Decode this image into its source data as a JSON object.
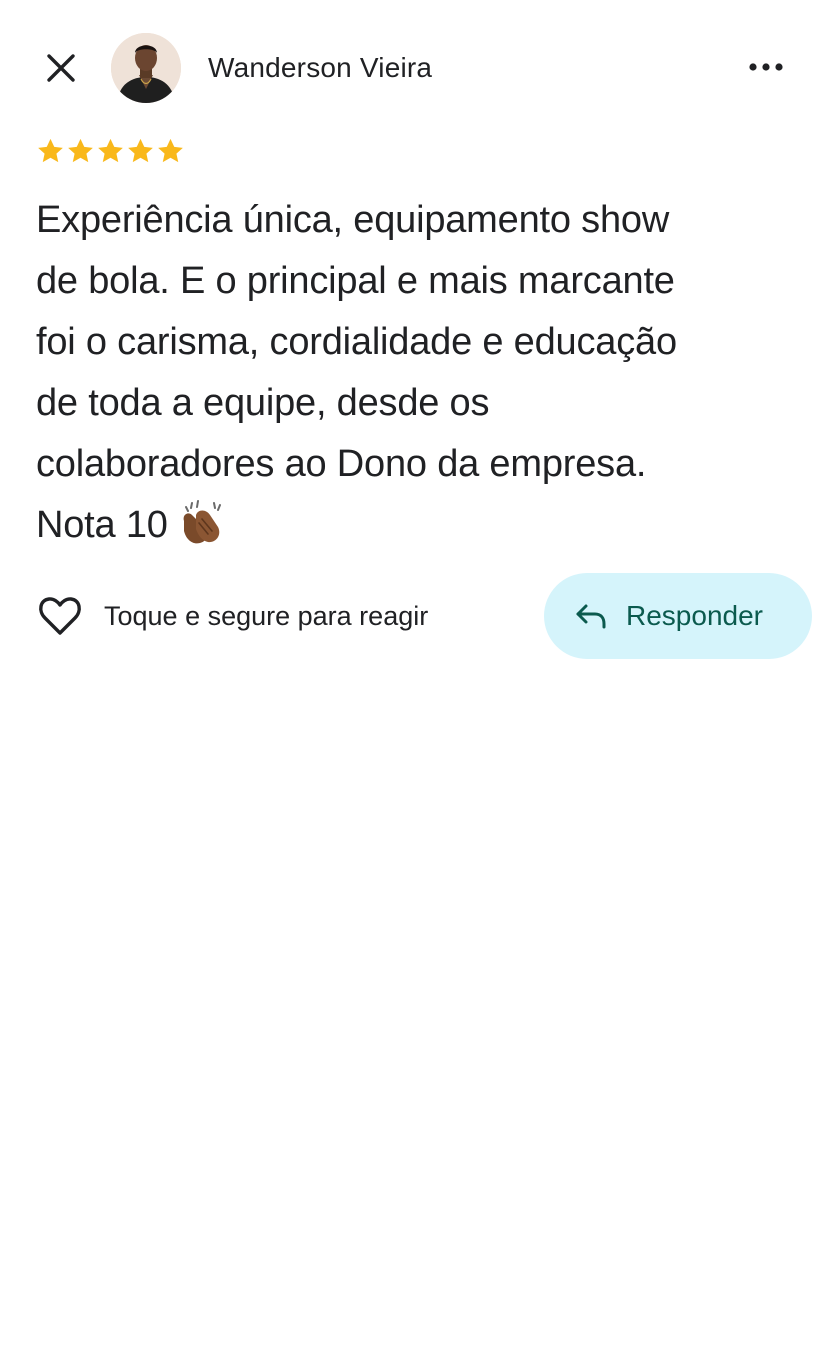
{
  "header": {
    "author_name": "Wanderson Vieira",
    "close_icon": "close-icon",
    "more_icon": "more-horizontal-icon"
  },
  "review": {
    "rating": 5,
    "max_rating": 5,
    "star_color": "#F9B81B",
    "lines": [
      "Experiência única, equipamento show",
      "de bola. E o principal e mais marcante",
      "foi o carisma, cordialidade e educação",
      "de toda a equipe, desde os",
      "colaboradores ao Dono da empresa.",
      "Nota 10"
    ],
    "emoji": "clapping-hands-emoji"
  },
  "actions": {
    "react_label": "Toque e segure para reagir",
    "reply_label": "Responder",
    "reply_bg_color": "#D5F4FB",
    "reply_text_color": "#0B5A4E"
  }
}
